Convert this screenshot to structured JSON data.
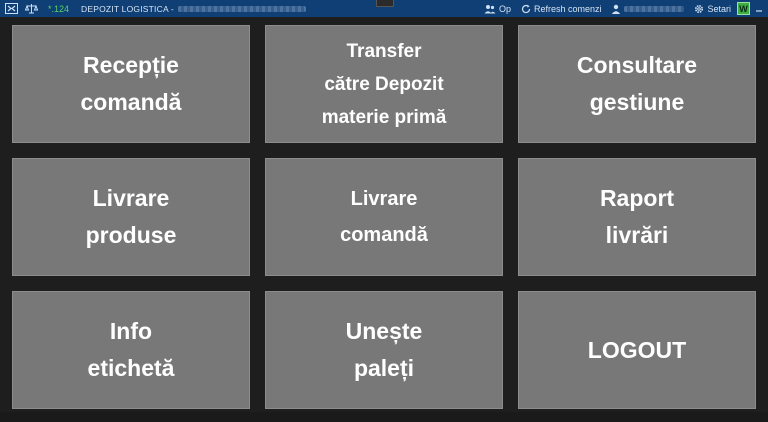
{
  "topbar": {
    "ip": "*.124",
    "depot_title": "DEPOZIT LOGISTICA -",
    "op_label": "Op",
    "refresh_label": "Refresh comenzi",
    "settings_label": "Setari",
    "w_badge": "W"
  },
  "tiles": [
    {
      "label": "Recepție\ncomandă"
    },
    {
      "label": "Transfer\ncătre Depozit\nmaterie primă"
    },
    {
      "label": "Consultare\ngestiune"
    },
    {
      "label": "Livrare\nproduse"
    },
    {
      "label": "Livrare\ncomandă"
    },
    {
      "label": "Raport\nlivrări"
    },
    {
      "label": "Info\netichetă"
    },
    {
      "label": "Unește\npaleți"
    },
    {
      "label": "LOGOUT"
    }
  ],
  "colors": {
    "topbar_bg": "#0f3f74",
    "tile_bg": "#787878",
    "page_bg": "#1e1e1e",
    "ip_green": "#57d06b"
  }
}
